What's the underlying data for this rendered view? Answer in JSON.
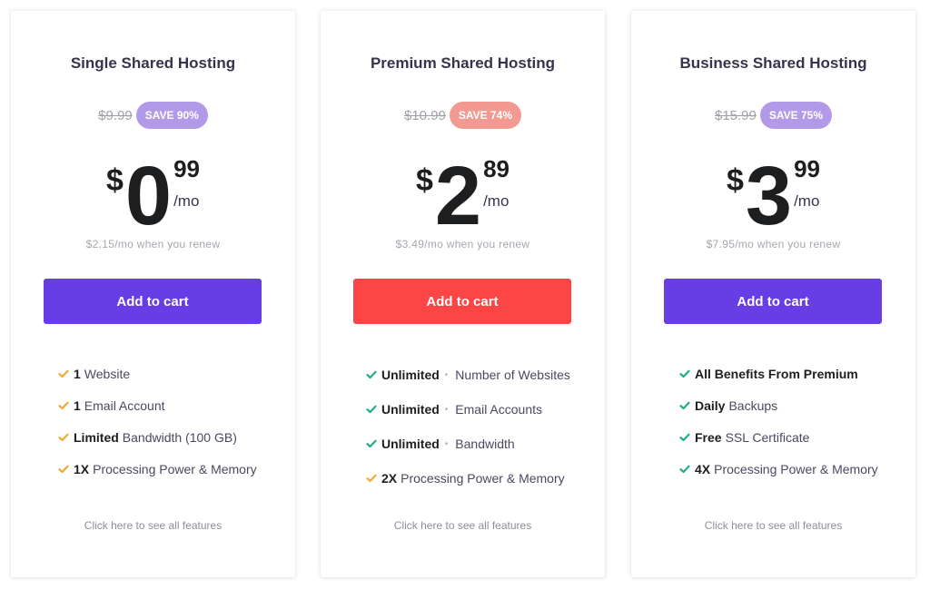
{
  "colors": {
    "purple": "#673de6",
    "red": "#fc4545",
    "badge_purple": "#b39ae8",
    "badge_red": "#f29a91",
    "check_green": "#21ac8a",
    "check_orange": "#f0a83b"
  },
  "plans": [
    {
      "title": "Single Shared Hosting",
      "old_price": "$9.99",
      "save_badge": "SAVE 90%",
      "currency": "$",
      "price_whole": "0",
      "price_cents": "99",
      "per": "/mo",
      "renew": "$2.15/mo when you renew",
      "cta": "Add to cart",
      "features": [
        {
          "bold": "1",
          "text": "Website",
          "icon": "check-icon",
          "check": "orange"
        },
        {
          "bold": "1",
          "text": "Email Account",
          "icon": "check-icon",
          "check": "orange"
        },
        {
          "bold": "Limited",
          "text": "Bandwidth (100 GB)",
          "icon": "check-icon",
          "check": "orange"
        },
        {
          "bold": "1X",
          "text": "Processing Power & Memory",
          "icon": "check-icon",
          "check": "orange"
        }
      ],
      "see_all": "Click here to see all features"
    },
    {
      "title": "Premium Shared Hosting",
      "old_price": "$10.99",
      "save_badge": "SAVE 74%",
      "currency": "$",
      "price_whole": "2",
      "price_cents": "89",
      "per": "/mo",
      "renew": "$3.49/mo when you renew",
      "cta": "Add to cart",
      "features": [
        {
          "bold": "Unlimited",
          "dot": "•",
          "text": "Number of Websites",
          "icon": "check-icon",
          "check": "green"
        },
        {
          "bold": "Unlimited",
          "dot": "•",
          "text": "Email Accounts",
          "icon": "check-icon",
          "check": "green"
        },
        {
          "bold": "Unlimited",
          "dot": "•",
          "text": "Bandwidth",
          "icon": "check-icon",
          "check": "green"
        },
        {
          "bold": "2X",
          "text": "Processing Power & Memory",
          "icon": "check-icon",
          "check": "orange"
        }
      ],
      "see_all": "Click here to see all features"
    },
    {
      "title": "Business Shared Hosting",
      "old_price": "$15.99",
      "save_badge": "SAVE 75%",
      "currency": "$",
      "price_whole": "3",
      "price_cents": "99",
      "per": "/mo",
      "renew": "$7.95/mo when you renew",
      "cta": "Add to cart",
      "features": [
        {
          "bold": "All Benefits From Premium",
          "text": "",
          "icon": "check-icon",
          "check": "green"
        },
        {
          "bold": "Daily",
          "text": "Backups",
          "icon": "check-icon",
          "check": "green"
        },
        {
          "bold": "Free",
          "text": "SSL Certificate",
          "icon": "check-icon",
          "check": "green"
        },
        {
          "bold": "4X",
          "text": "Processing Power & Memory",
          "icon": "check-icon",
          "check": "green"
        }
      ],
      "see_all": "Click here to see all features"
    }
  ]
}
